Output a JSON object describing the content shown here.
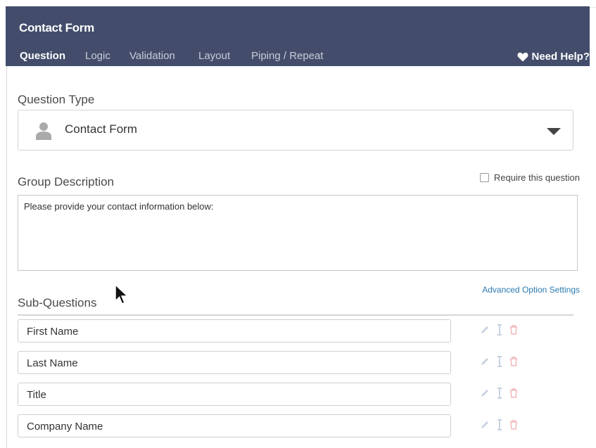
{
  "header": {
    "title": "Contact Form",
    "tabs": [
      {
        "label": "Question",
        "active": true
      },
      {
        "label": "Logic",
        "active": false
      },
      {
        "label": "Validation",
        "active": false
      },
      {
        "label": "Layout",
        "active": false
      },
      {
        "label": "Piping / Repeat",
        "active": false
      }
    ],
    "help_label": "Need Help?"
  },
  "question_type": {
    "label": "Question Type",
    "selected": "Contact Form",
    "icon": "person-icon"
  },
  "group_description": {
    "label": "Group Description",
    "require_label": "Require this question",
    "require_checked": false,
    "text": "Please provide your contact information below:"
  },
  "sub_questions": {
    "label": "Sub-Questions",
    "advanced_link": "Advanced Option Settings",
    "items": [
      {
        "label": "First Name"
      },
      {
        "label": "Last Name"
      },
      {
        "label": "Title"
      },
      {
        "label": "Company Name"
      }
    ]
  },
  "colors": {
    "header_bg": "#434d6b",
    "link": "#2a7ab0",
    "delete_icon": "#f0b8b8",
    "edit_icon": "#c8d2e0"
  }
}
